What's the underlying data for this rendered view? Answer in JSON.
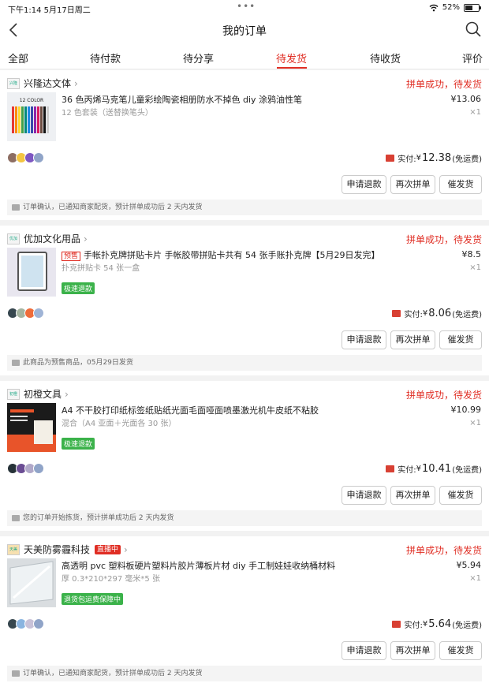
{
  "status_bar": {
    "time": "下午1:14  5月17日周二",
    "battery": "52%"
  },
  "nav": {
    "title": "我的订单"
  },
  "tabs": [
    "全部",
    "待付款",
    "待分享",
    "待发货",
    "待收货",
    "评价"
  ],
  "active_tab": 3,
  "actions": {
    "refund": "申请退款",
    "rebuy": "再次拼单",
    "urge": "催发货"
  },
  "labels": {
    "paid": "实付: ",
    "currency": "¥",
    "free_ship": "(免运费)"
  },
  "orders": [
    {
      "shop": "兴隆达文体",
      "status": "拼单成功，待发货",
      "title": "36 色丙烯马克笔儿童彩绘陶瓷相册防水不掉色 diy 涂鸦油性笔",
      "presale_tag": "",
      "spec": "12 色套装（送替换笔头）",
      "price": "¥13.06",
      "qty": "×1",
      "tag": "",
      "paid": "12.38",
      "note": "订单确认，已通知商家配货，预计拼单成功后 2 天内发货"
    },
    {
      "shop": "优加文化用品",
      "status": "拼单成功，待发货",
      "title": "手帐扑克牌拼贴卡片 手帐胶带拼贴卡共有 54 张手账扑克牌【5月29日发完】",
      "presale_tag": "预售",
      "spec": "扑克拼贴卡 54 张一盒",
      "price": "¥8.5",
      "qty": "×1",
      "tag": "极速退款",
      "paid": "8.06",
      "note": "此商品为预售商品，05月29日发货"
    },
    {
      "shop": "初橙文具",
      "status": "拼单成功，待发货",
      "title": "A4 不干胶打印纸标签纸贴纸光面毛面哑面喷墨激光机牛皮纸不粘胶",
      "presale_tag": "",
      "spec": "混合（A4 亚面＋光面各 30 张）",
      "price": "¥10.99",
      "qty": "×1",
      "tag": "极速退款",
      "paid": "10.41",
      "note": "您的订单开始拣货，预计拼单成功后 2 天内发货"
    },
    {
      "shop": "天美防雾霾科技",
      "live": "直播中",
      "status": "拼单成功，待发货",
      "title": "高透明 pvc 塑料板硬片塑料片胶片薄板片材 diy 手工制娃娃收纳桶材料",
      "presale_tag": "",
      "spec": "厚 0.3*210*297 毫米*5 张",
      "price": "¥5.94",
      "qty": "×1",
      "tag": "退货包运费保障中",
      "paid": "5.64",
      "note": "订单确认，已通知商家配货，预计拼单成功后 2 天内发货"
    }
  ],
  "colors": {
    "accent": "#e02e24",
    "green_tag": "#3bb24a"
  },
  "icons": [
    "back-icon",
    "search-icon",
    "wifi-icon",
    "battery-icon",
    "chevron-right-icon",
    "red-packet-icon",
    "note-icon"
  ]
}
